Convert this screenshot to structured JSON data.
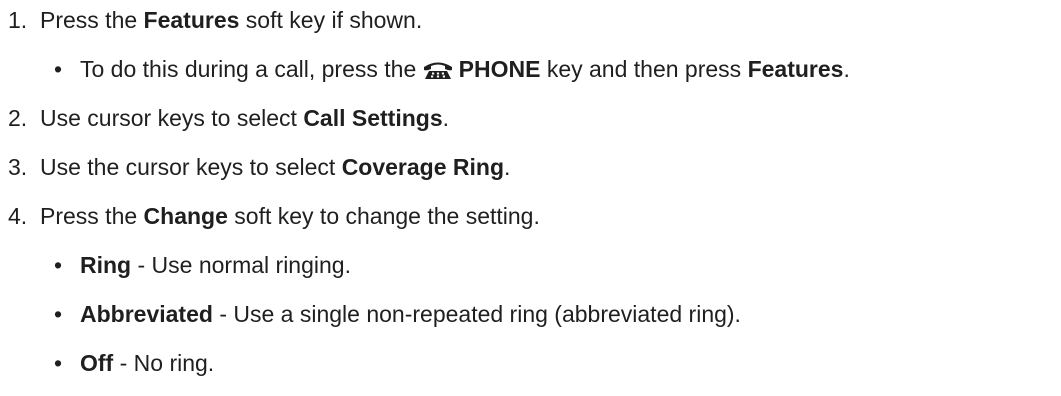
{
  "steps": [
    {
      "number": "1.",
      "pre": "Press the ",
      "bold": "Features",
      "post": " soft key if shown.",
      "sub": {
        "bullet": "•",
        "pre": "To do this during a call, press the ",
        "icon": "phone-icon",
        "bold1": "PHONE",
        "mid": " key and then press ",
        "bold2": "Features",
        "post": "."
      }
    },
    {
      "number": "2.",
      "pre": "Use cursor keys to select ",
      "bold": "Call Settings",
      "post": "."
    },
    {
      "number": "3.",
      "pre": "Use the cursor keys to select ",
      "bold": "Coverage Ring",
      "post": "."
    },
    {
      "number": "4.",
      "pre": "Press the ",
      "bold": "Change",
      "post": " soft key to change the setting.",
      "options": [
        {
          "bullet": "•",
          "bold": "Ring",
          "text": " - Use normal ringing."
        },
        {
          "bullet": "•",
          "bold": "Abbreviated",
          "text": " - Use a single non-repeated ring (abbreviated ring)."
        },
        {
          "bullet": "•",
          "bold": "Off",
          "text": " - No ring."
        }
      ]
    }
  ]
}
